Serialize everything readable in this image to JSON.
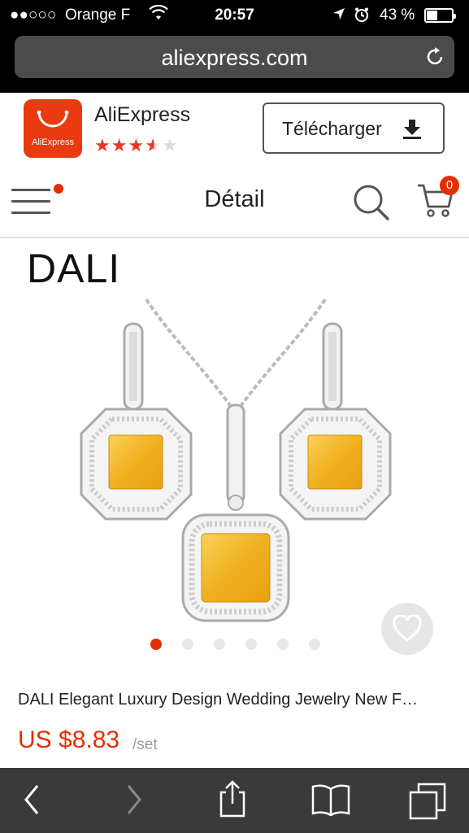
{
  "status_bar": {
    "signal": "●●○○○",
    "carrier": "Orange F",
    "time": "20:57",
    "battery_percent": "43 %",
    "battery_level": 0.43
  },
  "browser": {
    "url": "aliexpress.com"
  },
  "app_banner": {
    "app_name": "AliExpress",
    "logo_text": "AliExpress",
    "rating": 3.5,
    "stars": [
      "★",
      "★",
      "★",
      "★",
      "★"
    ],
    "download_label": "Télécharger"
  },
  "nav": {
    "title": "Détail",
    "cart_count": "0"
  },
  "product": {
    "brand": "DALI",
    "title": "DALI Elegant Luxury Design Wedding Jewelry New F…",
    "price": "US $8.83",
    "unit": "/set",
    "carousel_total": 6,
    "carousel_active": 0
  },
  "colors": {
    "accent": "#e62e04",
    "logo_bg": "#ea3a0f",
    "toolbar_bg": "#3a3a3a"
  }
}
